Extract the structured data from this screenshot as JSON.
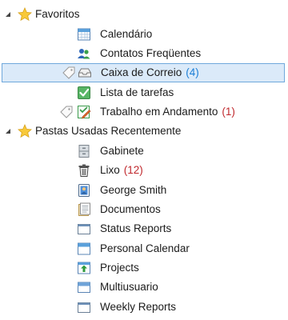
{
  "favorites": {
    "label": "Favoritos",
    "items": [
      {
        "label": "Calendário"
      },
      {
        "label": "Contatos Freqüentes"
      },
      {
        "label": "Caixa de Correio",
        "count": "(4)"
      },
      {
        "label": "Lista de tarefas"
      },
      {
        "label": "Trabalho em Andamento",
        "count": "(1)"
      }
    ]
  },
  "recent": {
    "label": "Pastas Usadas Recentemente",
    "items": [
      {
        "label": "Gabinete"
      },
      {
        "label": "Lixo",
        "count": "(12)"
      },
      {
        "label": "George Smith"
      },
      {
        "label": "Documentos"
      },
      {
        "label": "Status Reports"
      },
      {
        "label": "Personal Calendar"
      },
      {
        "label": "Projects"
      },
      {
        "label": "Multiusuario"
      },
      {
        "label": "Weekly Reports"
      }
    ]
  },
  "colors": {
    "selection_bg": "#dbeaf9",
    "selection_border": "#6fa8dc",
    "count_red": "#c0282d",
    "count_blue": "#1c7fd6"
  }
}
